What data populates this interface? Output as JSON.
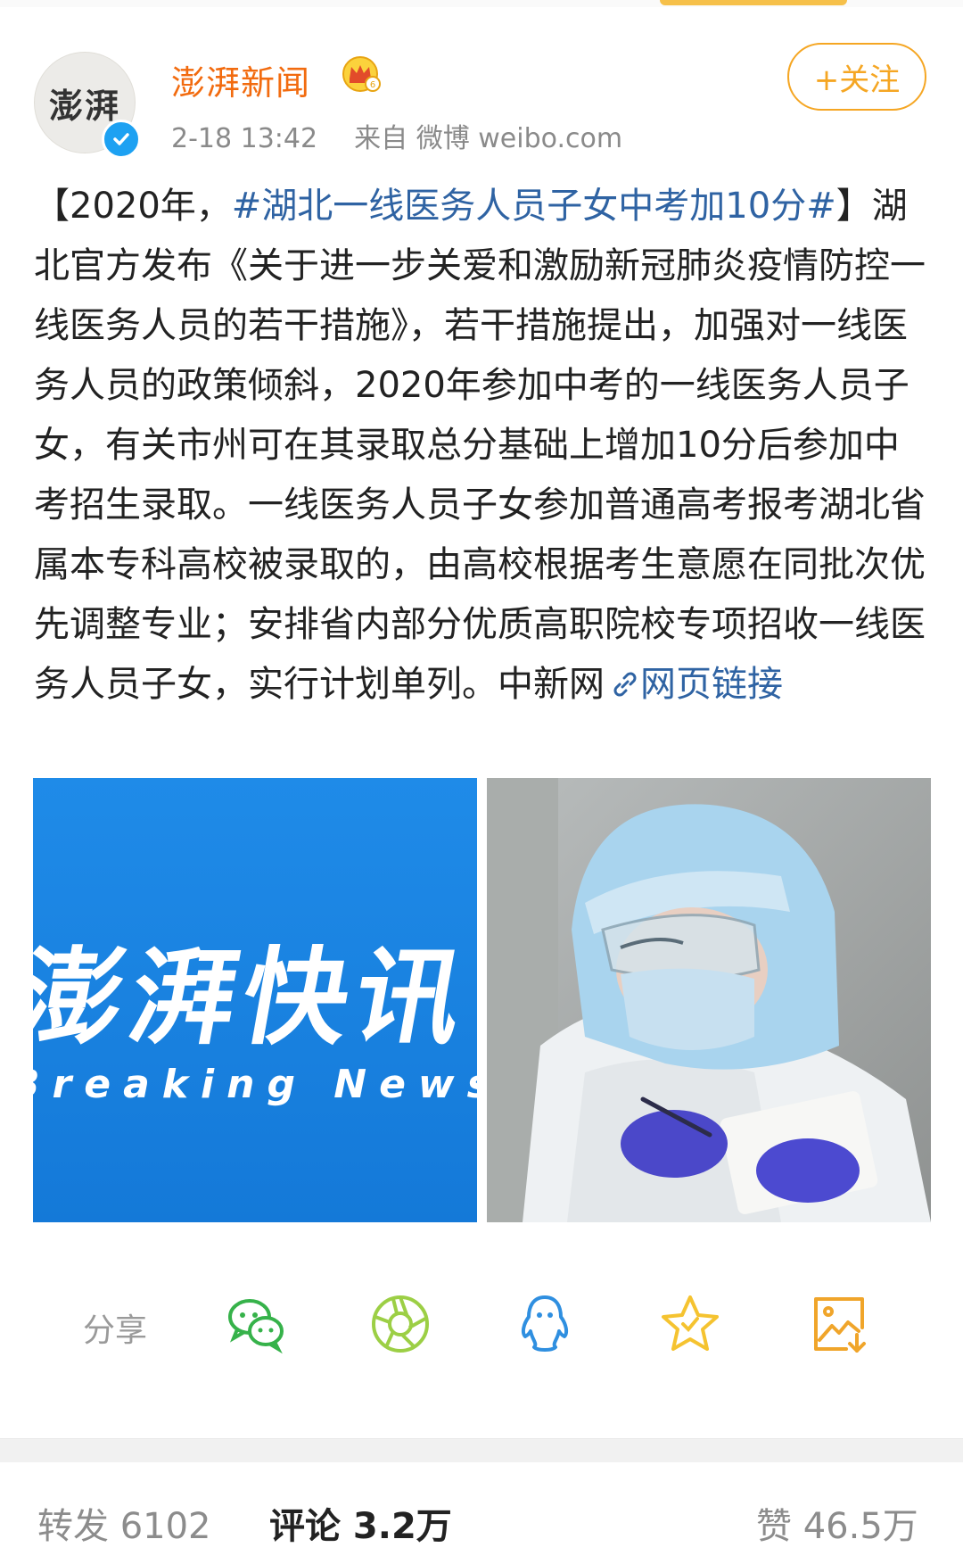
{
  "post": {
    "account_name": "澎湃新闻",
    "avatar_text": "澎湃",
    "time": "2-18 13:42",
    "source": "来自 微博 weibo.com",
    "follow_label": "+关注",
    "text_prefix": "【2020年，",
    "hashtag": "#湖北一线医务人员子女中考加10分#",
    "text_body": "】湖北官方发布《关于进一步关爱和激励新冠肺炎疫情防控一线医务人员的若干措施》，若干措施提出，加强对一线医务人员的政策倾斜，2020年参加中考的一线医务人员子女，有关市州可在其录取总分基础上增加10分后参加中考招生录取。一线医务人员子女参加普通高考报考湖北省属本专科高校被录取的，由高校根据考生意愿在同批次优先调整专业；安排省内部分优质高职院校专项招收一线医务人员子女，实行计划单列。中新网",
    "link_text": "网页链接"
  },
  "images": {
    "left_title": "澎湃快讯",
    "left_subtitle": "Breaking News"
  },
  "share": {
    "label": "分享",
    "icons": [
      "wechat-icon",
      "moments-icon",
      "qq-icon",
      "favorite-icon",
      "save-image-icon"
    ]
  },
  "stats": {
    "repost": "转发 6102",
    "comment": "评论 3.2万",
    "like": "赞 46.5万"
  },
  "colors": {
    "brand_orange": "#f26b0f",
    "follow": "#f5a623",
    "link_blue": "#2f63a3",
    "wechat_green": "#36b24a",
    "moments_green": "#9ccf45",
    "qq_blue": "#2f8fe0",
    "star_yellow": "#f5c330"
  }
}
